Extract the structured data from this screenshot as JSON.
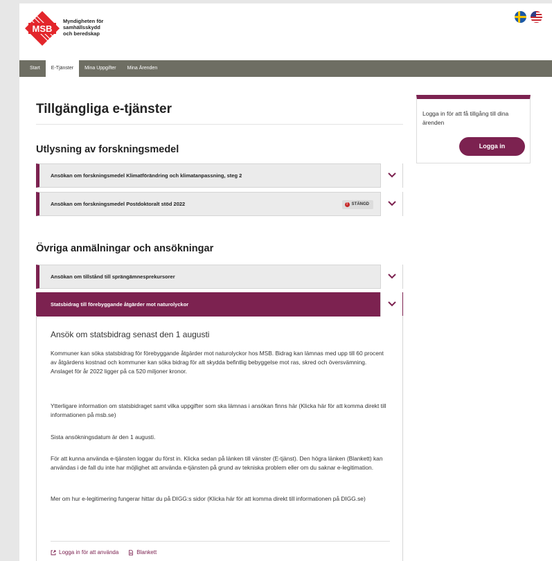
{
  "header": {
    "logo_text": "MSB",
    "agency_name": [
      "Myndigheten för",
      "samhällsskydd",
      "och beredskap"
    ],
    "languages": [
      "svenska",
      "english"
    ]
  },
  "nav": {
    "items": [
      {
        "label": "Start",
        "active": false
      },
      {
        "label": "E-Tjänster",
        "active": true
      },
      {
        "label": "Mina Uppgifter",
        "active": false
      },
      {
        "label": "Mina Ärenden",
        "active": false
      }
    ]
  },
  "main": {
    "title": "Tillgängliga e-tjänster",
    "sections": [
      {
        "title": "Utlysning av forskningsmedel",
        "items": [
          {
            "label": "Ansökan om forskningsmedel Klimatförändring och klimatanpassning, steg 2"
          },
          {
            "label": "Ansökan om forskningsmedel Postdoktoralt stöd 2022",
            "badge": "STÄNGD"
          }
        ]
      },
      {
        "title": "Övriga anmälningar och ansökningar",
        "items": [
          {
            "label": "Ansökan om tillstånd till sprängämnesprekursorer"
          },
          {
            "label": "Statsbidrag till förebyggande åtgärder mot naturolyckor",
            "open": true
          }
        ]
      }
    ],
    "panel": {
      "heading": "Ansök om statsbidrag senast den 1 augusti",
      "paragraphs": [
        "Kommuner kan söka statsbidrag för förebyggande åtgärder mot naturolyckor hos MSB. Bidrag kan lämnas med upp till 60 procent av åtgärdens kostnad och kommuner kan söka bidrag för att skydda befintlig bebyggelse mot ras, skred och översvämning. Anslaget för år 2022 ligger på ca 520 miljoner kronor.",
        "Ytterligare information om statsbidraget samt vilka uppgifter som ska lämnas i ansökan finns här (Klicka här för att komma direkt till informationen på msb.se)",
        "Sista ansökningsdatum är den 1 augusti.",
        "För att kunna använda e-tjänsten loggar du först in. Klicka sedan på länken till vänster (E-tjänst). Den högra länken (Blankett) kan användas i de fall du inte har möjlighet att använda e-tjänsten på grund av tekniska problem eller om du saknar e-legitimation.",
        "Mer om hur e-legitimering fungerar hittar du på DIGG:s sidor (Klicka här för att komma direkt till informationen på DIGG.se)"
      ],
      "links": {
        "login": "Logga in för att använda",
        "form": "Blankett"
      }
    }
  },
  "sidebar": {
    "text": "Logga in för att få tillgång till dina ärenden",
    "login_button": "Logga in"
  },
  "colors": {
    "brand": "#7c2250",
    "nav_bg": "#6e6e63",
    "logo_red": "#e3262b"
  }
}
